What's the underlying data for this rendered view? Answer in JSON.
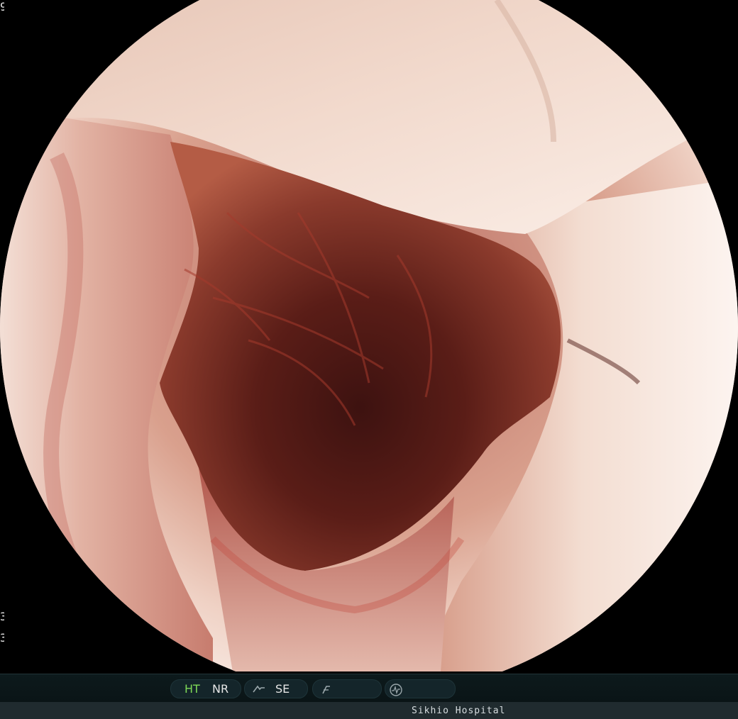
{
  "left_edge": {
    "top": "9",
    "bottom_1": "3",
    "bottom_2": "3"
  },
  "status_bar": {
    "ht_label": "HT",
    "nr_label": "NR",
    "se_label": "SE",
    "icons": [
      "structure-icon",
      "contrast-icon",
      "waveform-icon"
    ],
    "colors": {
      "active": "#7ed957",
      "inactive": "#e6e6e6",
      "icon": "#9aa7ab"
    }
  },
  "footer": {
    "hospital_name": "Sikhio Hospital"
  }
}
